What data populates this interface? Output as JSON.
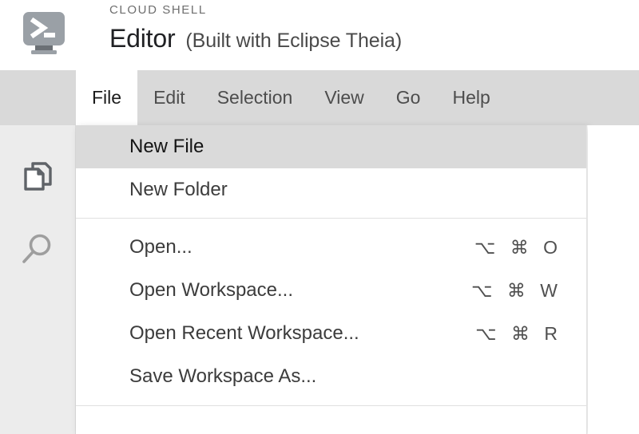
{
  "header": {
    "kicker": "CLOUD SHELL",
    "title": "Editor",
    "subtitle": "(Built with Eclipse Theia)",
    "icon": "cloud-shell-terminal-icon",
    "icon_color": "#9aa0a6"
  },
  "menubar": {
    "background": "#d9d9d9",
    "items": [
      {
        "label": "File",
        "active": true
      },
      {
        "label": "Edit",
        "active": false
      },
      {
        "label": "Selection",
        "active": false
      },
      {
        "label": "View",
        "active": false
      },
      {
        "label": "Go",
        "active": false
      },
      {
        "label": "Help",
        "active": false
      }
    ]
  },
  "sidebar": {
    "background": "#ececec",
    "items": [
      {
        "name": "explorer",
        "icon": "files-icon",
        "title": "Explorer"
      },
      {
        "name": "search",
        "icon": "search-icon",
        "title": "Search"
      }
    ]
  },
  "file_menu": {
    "highlight_color": "#dadada",
    "groups": [
      {
        "items": [
          {
            "label": "New File",
            "shortcut": "",
            "highlighted": true
          },
          {
            "label": "New Folder",
            "shortcut": "",
            "highlighted": false
          }
        ]
      },
      {
        "items": [
          {
            "label": "Open...",
            "shortcut": "⌥ ⌘ O",
            "highlighted": false
          },
          {
            "label": "Open Workspace...",
            "shortcut": "⌥ ⌘ W",
            "highlighted": false
          },
          {
            "label": "Open Recent Workspace...",
            "shortcut": "⌥ ⌘ R",
            "highlighted": false
          },
          {
            "label": "Save Workspace As...",
            "shortcut": "",
            "highlighted": false
          }
        ]
      }
    ]
  }
}
